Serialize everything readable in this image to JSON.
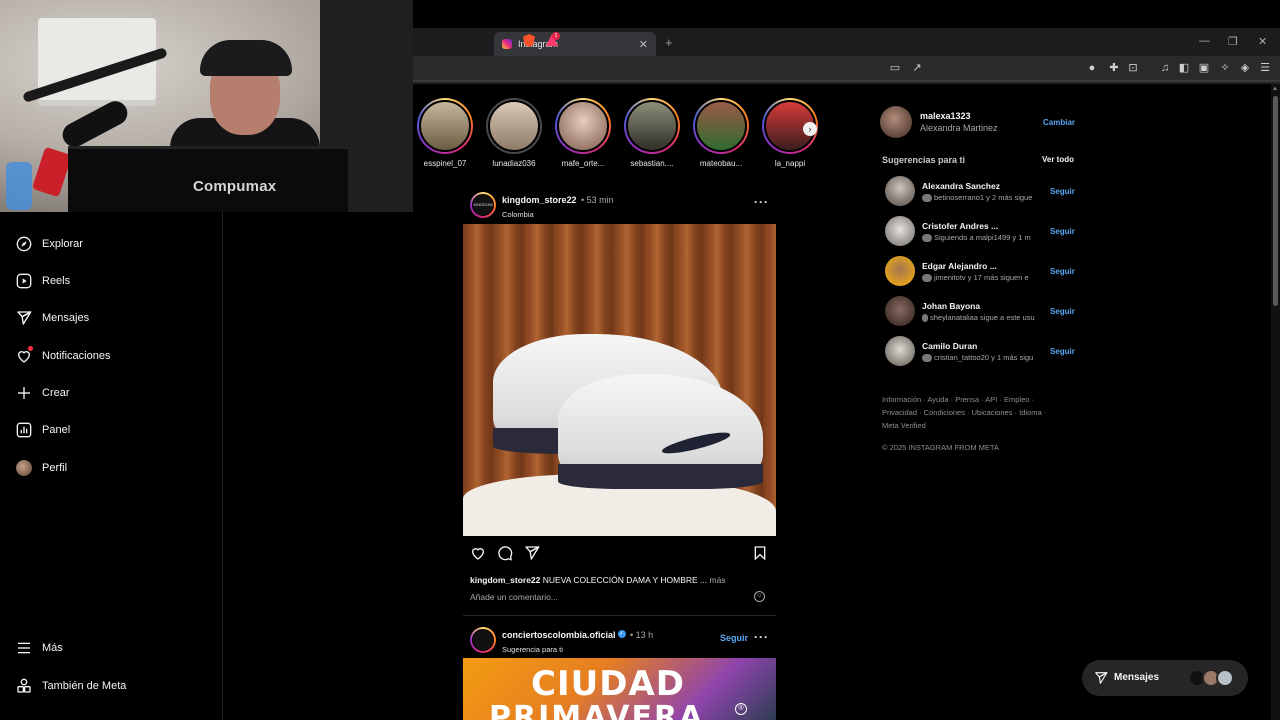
{
  "webcam": {
    "brand_text": "Compumax"
  },
  "browser": {
    "tab_title": "Instagram",
    "tab_close": "✕",
    "new_tab": "+",
    "window_controls": {
      "minimize": "—",
      "restore": "❐",
      "close": "✕"
    },
    "shield_badge": "1"
  },
  "sidebar": {
    "items": [
      {
        "label": "Explorar",
        "icon": "compass-icon"
      },
      {
        "label": "Reels",
        "icon": "reels-icon"
      },
      {
        "label": "Mensajes",
        "icon": "paper-plane-icon"
      },
      {
        "label": "Notificaciones",
        "icon": "heart-icon"
      },
      {
        "label": "Crear",
        "icon": "plus-icon"
      },
      {
        "label": "Panel",
        "icon": "dashboard-icon"
      },
      {
        "label": "Perfil",
        "icon": "avatar"
      }
    ],
    "more_label": "Más",
    "meta_label": "También de Meta"
  },
  "stories": [
    {
      "name": "esspinel_07",
      "seen": false
    },
    {
      "name": "lunadiaz036",
      "seen": true
    },
    {
      "name": "mafe_orte...",
      "seen": false
    },
    {
      "name": "sebastian....",
      "seen": false
    },
    {
      "name": "mateobau...",
      "seen": false
    },
    {
      "name": "la_nappi",
      "seen": false
    }
  ],
  "post1": {
    "username": "kingdom_store22",
    "time": "• 53 min",
    "location": "Colombia",
    "avatar_text": "KINGDOM",
    "caption_user": "kingdom_store22",
    "caption_text": "NUEVA COLECCIÓN DAMA Y HOMBRE ...",
    "caption_more": "más",
    "comment_placeholder": "Añade un comentario..."
  },
  "post2": {
    "username": "conciertoscolombia.oficial",
    "time": "• 13 h",
    "subtitle": "Sugerencia para ti",
    "follow": "Seguir",
    "image_line1": "CIUDAD",
    "image_line2": "PRIMAVERA",
    "image_mark": "®"
  },
  "current_user": {
    "username": "malexa1323",
    "full_name": "Alexandra Martinez",
    "switch_label": "Cambiar"
  },
  "suggestions": {
    "title": "Sugerencias para ti",
    "see_all": "Ver todo",
    "follow_label": "Seguir",
    "items": [
      {
        "name": "Alexandra Sanchez",
        "sub": "betinoserrano1 y 2 más sigue"
      },
      {
        "name": "Cristofer Andres ...",
        "sub": "Siguiendo a malpi1499 y 1 m"
      },
      {
        "name": "Edgar Alejandro ...",
        "sub": "jimenitotv y 17 más siguen e"
      },
      {
        "name": "Johan Bayona",
        "sub": "sheylanataliaa sigue a este usu"
      },
      {
        "name": "Camilo Duran",
        "sub": "cristian_tattoo20 y 1 más sigu"
      }
    ]
  },
  "footer": {
    "links_line1": "Información · Ayuda · Prensa · API · Empleo ·",
    "links_line2": "Privacidad · Condiciones · Ubicaciones · Idioma ·",
    "links_line3": "Meta Verified",
    "copyright": "© 2025 INSTAGRAM FROM META"
  },
  "messages_pill": {
    "label": "Mensajes"
  },
  "colors": {
    "link_blue": "#5aa7f5",
    "background": "#000000",
    "notification_red": "#ff3040"
  }
}
